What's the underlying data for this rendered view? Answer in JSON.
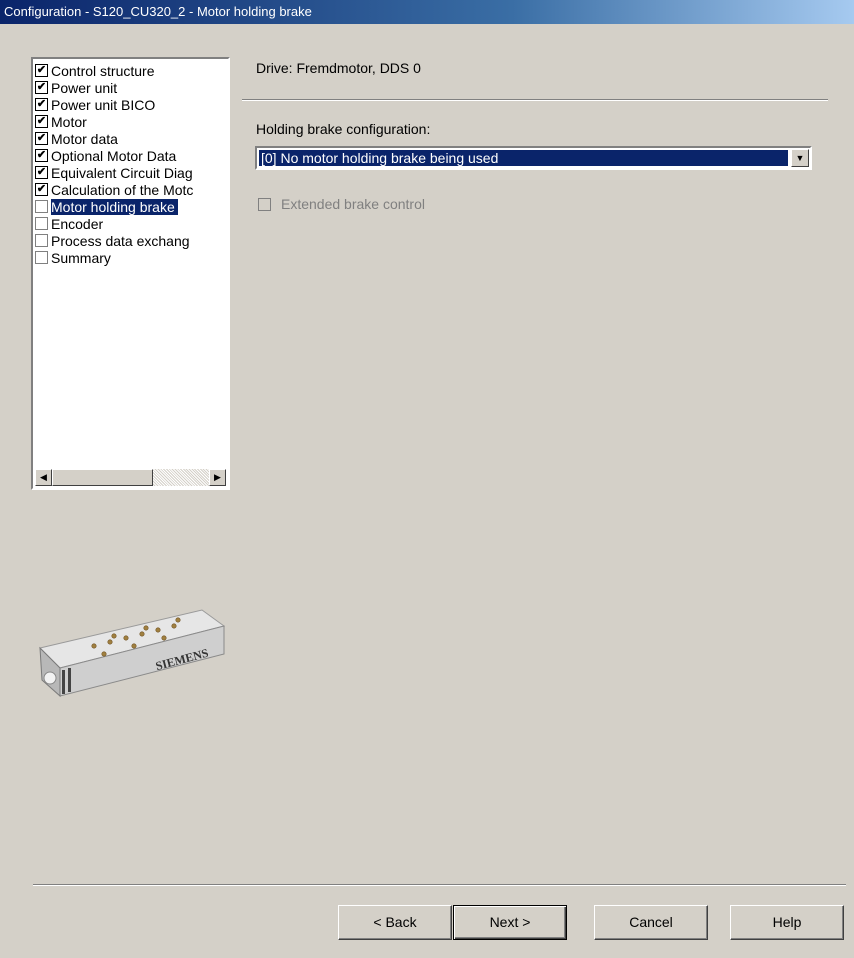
{
  "window": {
    "title": "Configuration - S120_CU320_2 - Motor holding brake"
  },
  "tree": {
    "items": [
      {
        "label": "Control structure",
        "checked": "✔"
      },
      {
        "label": "Power unit",
        "checked": "✔"
      },
      {
        "label": "Power unit BICO",
        "checked": "✔"
      },
      {
        "label": "Motor",
        "checked": "✔"
      },
      {
        "label": "Motor data",
        "checked": "✔"
      },
      {
        "label": "Optional Motor Data",
        "checked": "✔"
      },
      {
        "label": "Equivalent Circuit Diag",
        "checked": "✔"
      },
      {
        "label": "Calculation of the Motc",
        "checked": "✔"
      },
      {
        "label": "Motor holding brake",
        "checked": ""
      },
      {
        "label": "Encoder",
        "checked": ""
      },
      {
        "label": "Process data exchang",
        "checked": ""
      },
      {
        "label": "Summary",
        "checked": ""
      }
    ],
    "selected_index": 8
  },
  "main": {
    "drive_label": "Drive: Fremdmotor, DDS 0",
    "brake_config_label": "Holding brake configuration:",
    "brake_config_value": "[0] No motor holding brake being used",
    "extended_brake_label": "Extended brake control"
  },
  "device_image": {
    "brand_text": "SIEMENS"
  },
  "buttons": {
    "back": "< Back",
    "next": "Next >",
    "cancel": "Cancel",
    "help": "Help"
  }
}
